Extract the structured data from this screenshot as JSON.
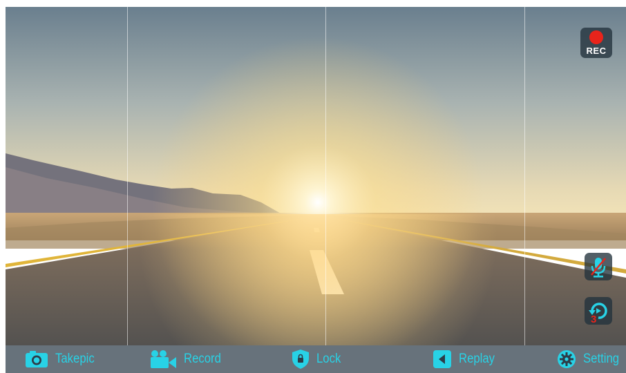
{
  "side_controls": {
    "rec_label": "REC",
    "rec_icon": "record-dot-icon",
    "mic_icon": "mic-muted-icon",
    "timer_icon": "timer-replay-icon",
    "timer_value": "3"
  },
  "bottom_bar": {
    "items": [
      {
        "label": "Takepic",
        "icon": "camera-icon"
      },
      {
        "label": "Record",
        "icon": "video-camera-icon"
      },
      {
        "label": "Lock",
        "icon": "shield-lock-icon"
      },
      {
        "label": "Replay",
        "icon": "play-square-icon"
      },
      {
        "label": "Setting",
        "icon": "gear-icon"
      }
    ]
  },
  "colors": {
    "accent": "#28d2e6",
    "rec_red": "#e8241b",
    "bar_background": "#2d3c48"
  }
}
